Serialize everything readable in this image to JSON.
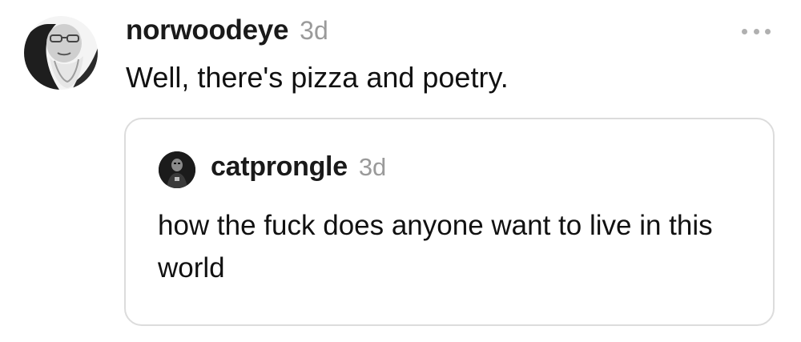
{
  "post": {
    "username": "norwoodeye",
    "timestamp": "3d",
    "text": "Well, there's pizza and poetry.",
    "avatar_icon": "bearded-man-avatar",
    "more_icon": "more-horizontal-icon"
  },
  "quoted_post": {
    "username": "catprongle",
    "timestamp": "3d",
    "text": "how the fuck does anyone want to live in this world",
    "avatar_icon": "dark-figure-avatar"
  },
  "colors": {
    "text": "#111111",
    "secondary_text": "#9a9a9a",
    "border": "#dcdcdc",
    "background": "#ffffff"
  }
}
